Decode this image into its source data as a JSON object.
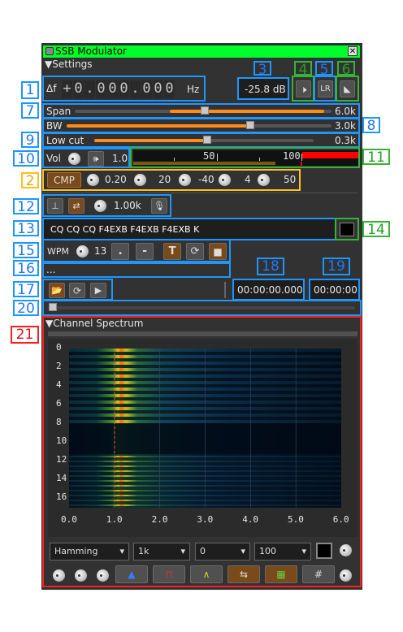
{
  "window": {
    "title": "SSB Modulator"
  },
  "settings": {
    "section_label": "Settings",
    "delta_f_label": "Δf",
    "freq_sign": "+",
    "freq_digits": [
      "0",
      ".",
      "0",
      "0",
      "0",
      ".",
      "0",
      "0",
      "0"
    ],
    "freq_unit": "Hz",
    "power_readout": "-25.8  dB",
    "span_label": "Span",
    "span_value": "6.0k",
    "span_level": 0.37,
    "bw_label": "BW",
    "bw_value": "3.0k",
    "bw_level": 0.69,
    "lowcut_label": "Low cut",
    "lowcut_value": "0.3k",
    "lowcut_level": 0.56,
    "vol_label": "Vol",
    "vol_value": "1.0",
    "meter_ticks": [
      "50",
      "100"
    ],
    "cmp_label": "CMP",
    "cmp_values": [
      "0.20",
      "20",
      "-40",
      "4",
      "50"
    ],
    "tone_value": "1.00k",
    "text_message": "CQ CQ CQ F4EXB F4EXB F4EXB K",
    "wpm_label": "WPM",
    "wpm_value": "13",
    "dot_label": ".",
    "dash_label": "-",
    "morse_text_icon": "T",
    "file_name": "...",
    "file_position": "00:00:00.000",
    "file_length": "00:00:00"
  },
  "spectrum": {
    "section_label": "Channel Spectrum",
    "y_ticks": [
      "0",
      "2",
      "4",
      "6",
      "8",
      "10",
      "12",
      "14",
      "16"
    ],
    "x_ticks": [
      "0.0",
      "1.0",
      "2.0",
      "3.0",
      "4.0",
      "5.0",
      "6.0"
    ],
    "window_combo": "Hamming",
    "fft_combo": "1k",
    "ref_combo": "0",
    "range_combo": "100"
  },
  "callouts": [
    "1",
    "2",
    "3",
    "4",
    "5",
    "6",
    "7",
    "8",
    "9",
    "10",
    "11",
    "12",
    "13",
    "14",
    "15",
    "16",
    "17",
    "18",
    "19",
    "20",
    "21"
  ],
  "colors": {
    "titlebar": "#00ff2a",
    "accent_blue": "#1e96ff",
    "accent_green": "#35b535",
    "accent_orange": "#ffbf1f",
    "accent_red": "#ff1e1e",
    "slider": "#ff8c1a"
  }
}
